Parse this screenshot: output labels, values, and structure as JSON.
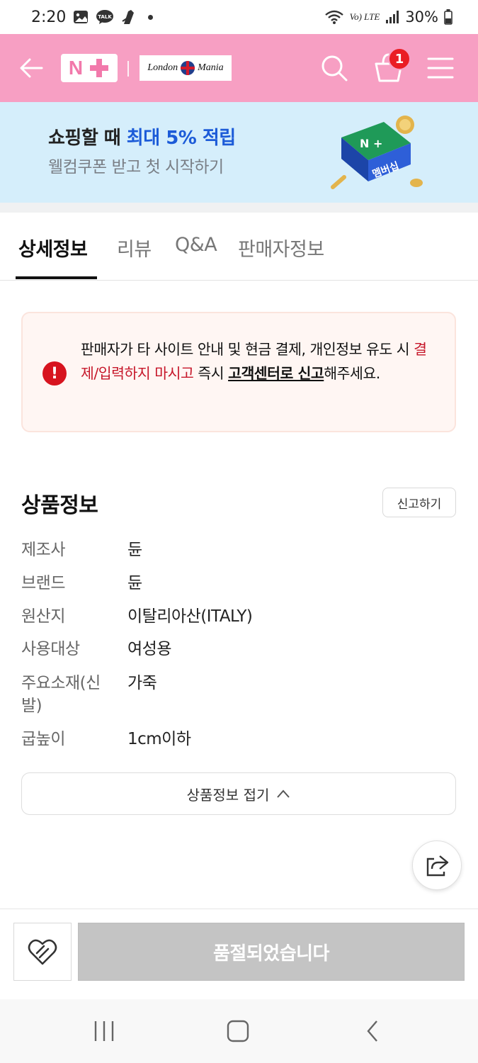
{
  "status_bar": {
    "time": "2:20",
    "battery": "30%",
    "talk_label": "TALK",
    "network": "Vo) LTE"
  },
  "header": {
    "logo_text": "N",
    "store_name_left": "London",
    "store_name_right": "Mania",
    "cart_count": "1",
    "accent_color": "#f79fc3"
  },
  "promo": {
    "title_prefix": "쇼핑할 때 ",
    "title_highlight": "최대 5% 적립",
    "subtitle": "웰컴쿠폰 받고 첫 시작하기",
    "badge_top": "N +",
    "badge_bottom": "멤버십"
  },
  "tabs": [
    {
      "label": "상세정보",
      "active": true
    },
    {
      "label": "리뷰",
      "active": false
    },
    {
      "label": "Q&A",
      "active": false
    },
    {
      "label": "판매자정보",
      "active": false
    }
  ],
  "warning": {
    "text_1": "판매자가 타 사이트 안내 및 현금 결제, 개인정보 유도 시 ",
    "text_red": "결제/입력하지 마시고",
    "text_2": " 즉시 ",
    "text_link": "고객센터로 신고",
    "text_3": "해주세요.",
    "icon": "!"
  },
  "product_info": {
    "title": "상품정보",
    "report_label": "신고하기",
    "rows": [
      {
        "key": "제조사",
        "value": "듄"
      },
      {
        "key": "브랜드",
        "value": "듄"
      },
      {
        "key": "원산지",
        "value": "이탈리아산(ITALY)"
      },
      {
        "key": "사용대상",
        "value": "여성용"
      },
      {
        "key": "주요소재(신발)",
        "value": "가죽"
      },
      {
        "key": "굽높이",
        "value": "1cm이하"
      }
    ],
    "collapse_label": "상품정보 접기"
  },
  "bottom_bar": {
    "soldout_label": "품절되었습니다"
  }
}
